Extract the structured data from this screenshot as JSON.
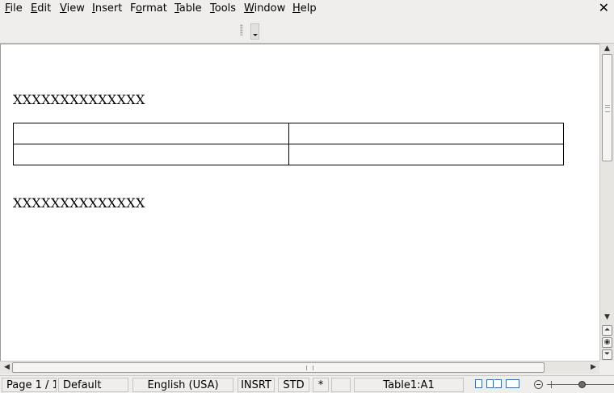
{
  "menubar": {
    "items": [
      {
        "label": "File",
        "key": "F"
      },
      {
        "label": "Edit",
        "key": "E"
      },
      {
        "label": "View",
        "key": "V"
      },
      {
        "label": "Insert",
        "key": "I"
      },
      {
        "label": "Format",
        "key": "o"
      },
      {
        "label": "Table",
        "key": "T"
      },
      {
        "label": "Tools",
        "key": "T"
      },
      {
        "label": "Window",
        "key": "W"
      },
      {
        "label": "Help",
        "key": "H"
      }
    ],
    "close_glyph": "✕"
  },
  "document": {
    "paragraph1": "XXXXXXXXXXXXXX",
    "paragraph2": "XXXXXXXXXXXXXX",
    "table": {
      "rows": [
        [
          "",
          ""
        ],
        [
          "",
          ""
        ]
      ]
    }
  },
  "statusbar": {
    "page": "Page 1 / 1",
    "page_style": "Default",
    "language": "English (USA)",
    "insert_mode": "INSRT",
    "selection_mode": "STD",
    "modified": "*",
    "signature": "",
    "cell": "Table1:A1"
  },
  "icons": {
    "menu_close": "close-icon",
    "scroll_up": "arrow-up-icon",
    "scroll_down": "arrow-down-icon",
    "scroll_left": "arrow-left-icon",
    "scroll_right": "arrow-right-icon",
    "prev_page": "double-arrow-up-icon",
    "navigator": "navigation-icon",
    "next_page": "double-arrow-down-icon",
    "zoom_out": "zoom-out-icon"
  }
}
